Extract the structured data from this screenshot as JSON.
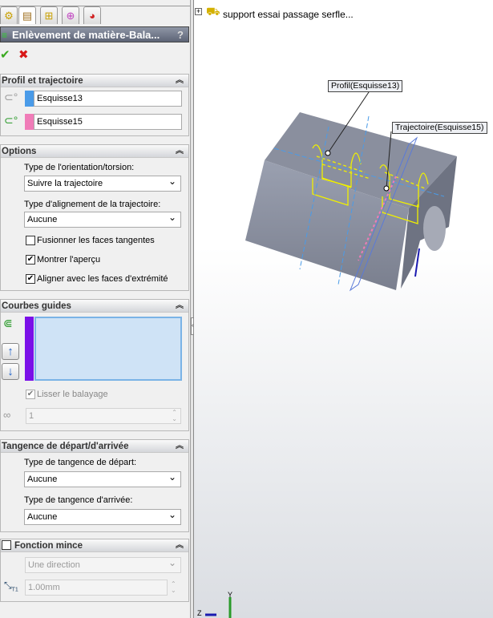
{
  "tabs": [
    {
      "icon": "feature-manager-icon"
    },
    {
      "icon": "property-manager-icon"
    },
    {
      "icon": "configuration-manager-icon"
    },
    {
      "icon": "dimxpert-icon"
    },
    {
      "icon": "display-manager-icon"
    }
  ],
  "title": "Enlèvement de matière-Bala...",
  "help": "?",
  "actions": {
    "ok": "✔",
    "cancel": "✖"
  },
  "profile": {
    "header": "Profil et trajectoire",
    "profile_value": "Esquisse13",
    "path_value": "Esquisse15",
    "profile_color": "#4a9be8",
    "path_color": "#f07cb8"
  },
  "options": {
    "header": "Options",
    "orient_label": "Type de l'orientation/torsion:",
    "orient_value": "Suivre la trajectoire",
    "align_label": "Type d'alignement de la trajectoire:",
    "align_value": "Aucune",
    "merge_label": "Fusionner les faces tangentes",
    "merge_checked": false,
    "preview_label": "Montrer l'aperçu",
    "preview_checked": true,
    "end_label": "Aligner avec les faces d'extrémité",
    "end_checked": true
  },
  "guides": {
    "header": "Courbes guides",
    "up": "↑",
    "down": "↓",
    "smooth_label": "Lisser le balayage",
    "smooth_checked": true,
    "count_value": "1",
    "color": "#7a10e8"
  },
  "tangency": {
    "header": "Tangence de départ/d'arrivée",
    "start_label": "Type de tangence de départ:",
    "start_value": "Aucune",
    "end_label": "Type de tangence d'arrivée:",
    "end_value": "Aucune"
  },
  "thin": {
    "header": "Fonction mince",
    "checked": false,
    "direction_value": "Une direction",
    "thickness_value": "1.00mm",
    "thickness_icon_label": "T1"
  },
  "tree": {
    "expand": "+",
    "part_name": "support essai passage serfle..."
  },
  "viewport": {
    "profile_callout": "Profil(Esquisse13)",
    "path_callout": "Trajectoire(Esquisse15)",
    "axis_y": "Y",
    "axis_z": "Z"
  }
}
